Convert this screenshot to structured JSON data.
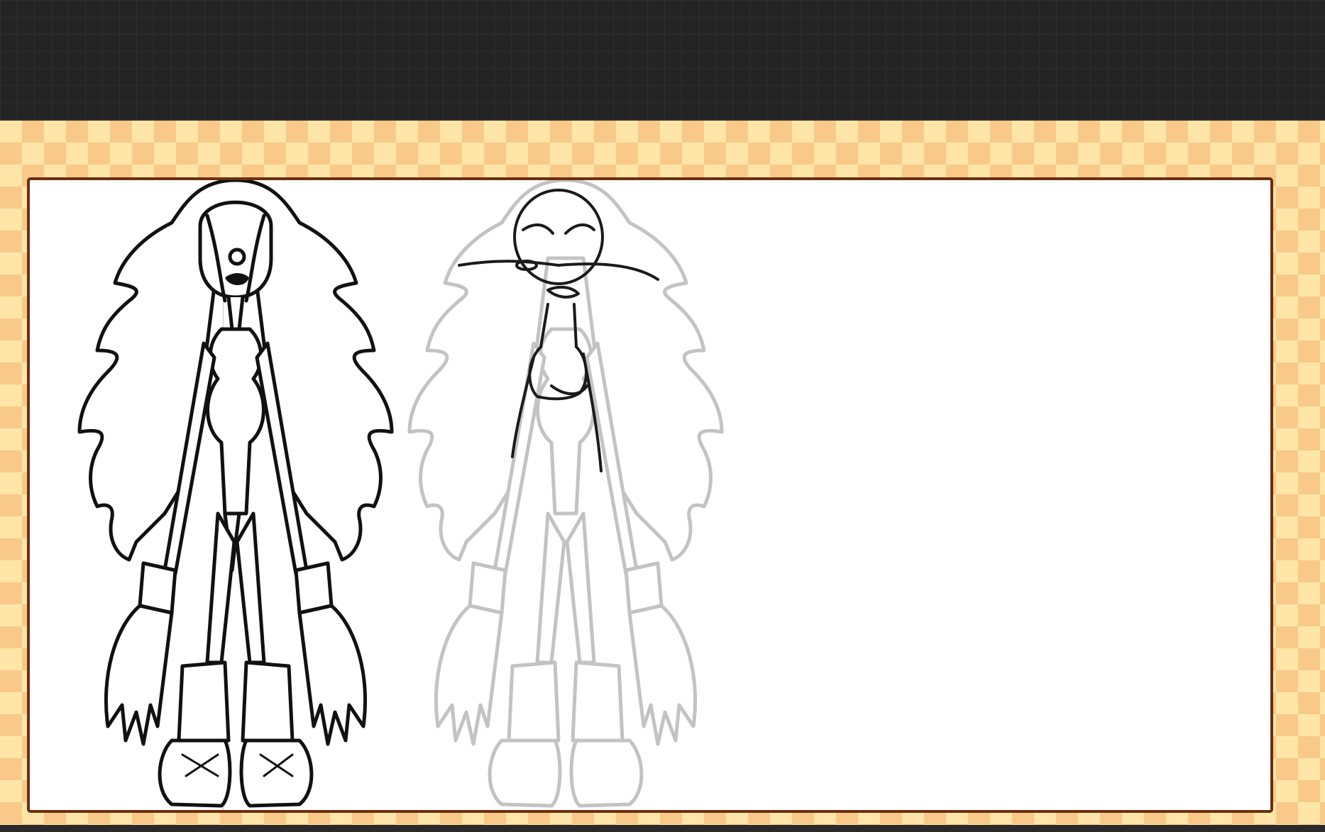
{
  "window": {
    "title": ""
  },
  "canvas": {
    "background_color": "#ffffff",
    "frame_border_color": "#6b2f12",
    "checker_light": "#ffe6a8",
    "checker_dark": "#f9c98a",
    "workspace_color": "#242424"
  },
  "figures": [
    {
      "icon": "inked-character-drawing",
      "style": "ink"
    },
    {
      "icon": "ghost-reference-drawing",
      "style": "onion-skin"
    },
    {
      "icon": "sketch-pose-drawing",
      "style": "sketch"
    }
  ]
}
